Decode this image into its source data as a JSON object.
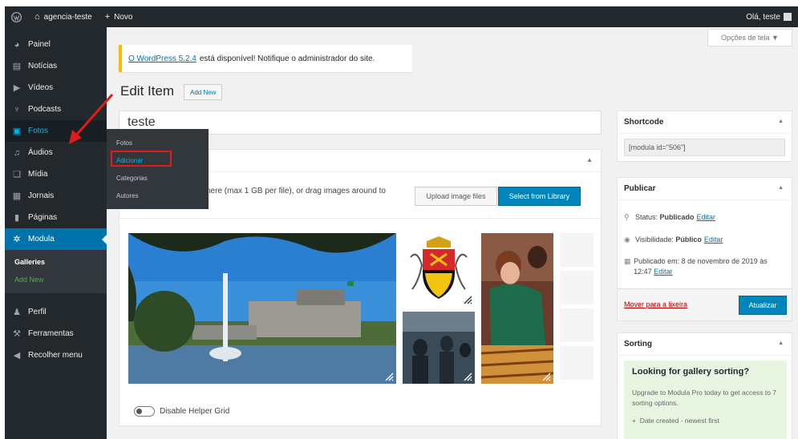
{
  "admin_bar": {
    "site_name": "agencia-teste",
    "new_label": "Novo",
    "greeting": "Olá, teste"
  },
  "sidebar": {
    "items": [
      {
        "label": "Painel",
        "icon": "dashboard-icon"
      },
      {
        "label": "Notícias",
        "icon": "news-icon"
      },
      {
        "label": "Vídeos",
        "icon": "video-icon"
      },
      {
        "label": "Podcasts",
        "icon": "microphone-icon"
      },
      {
        "label": "Fotos",
        "icon": "photo-icon"
      },
      {
        "label": "Áudios",
        "icon": "music-icon"
      },
      {
        "label": "Mídia",
        "icon": "media-icon"
      },
      {
        "label": "Jornais",
        "icon": "newspaper-icon"
      },
      {
        "label": "Páginas",
        "icon": "pages-icon"
      },
      {
        "label": "Modula",
        "icon": "gear-icon"
      }
    ],
    "modula_submenu": [
      "Galleries",
      "Add New"
    ],
    "bottom_items": [
      {
        "label": "Perfil",
        "icon": "user-icon"
      },
      {
        "label": "Ferramentas",
        "icon": "wrench-icon"
      },
      {
        "label": "Recolher menu",
        "icon": "collapse-icon"
      }
    ]
  },
  "flyout": {
    "items": [
      "Fotos",
      "Adicionar",
      "Categorias",
      "Autores"
    ]
  },
  "screen_options_label": "Opções de tela ▼",
  "notice": {
    "link_text": "O WordPress 5.2.4",
    "text": "está disponível! Notifique o administrador do site."
  },
  "page_title": "Edit Item",
  "add_new_label": "Add New",
  "title_value": "teste",
  "gallery": {
    "upload_text": "here (max 1 GB per file), or drag images around to",
    "upload_button": "Upload image files",
    "library_button": "Select from Library",
    "helper_label": "Disable Helper Grid"
  },
  "shortcode": {
    "title": "Shortcode",
    "value": "[modula id=\"506\"]"
  },
  "publish": {
    "title": "Publicar",
    "status_label": "Status:",
    "status_value": "Publicado",
    "visibility_label": "Visibilidade:",
    "visibility_value": "Público",
    "published_text": "Publicado em: 8 de novembro de 2019 às 12:47",
    "edit_label": "Editar",
    "trash_label": "Mover para a lixeira",
    "update_label": "Atualizar"
  },
  "sorting": {
    "title": "Sorting",
    "promo_heading": "Looking for gallery sorting?",
    "promo_text": "Upgrade to Modula Pro today to get access to 7 sorting options.",
    "promo_item": "Date created - newest first"
  },
  "colors": {
    "admin_dark": "#23282d",
    "wp_blue": "#0073aa",
    "button_blue": "#0085ba",
    "highlight_red": "#e01b1b",
    "notice_yellow": "#ffb900"
  }
}
